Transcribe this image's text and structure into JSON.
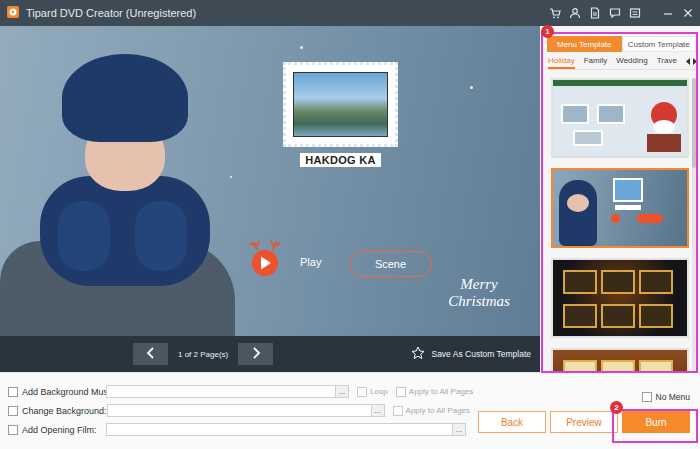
{
  "window": {
    "title": "Tipard DVD Creator (Unregistered)"
  },
  "preview": {
    "title": "HAKDOG KA",
    "play": "Play",
    "scene": "Scene",
    "greeting": "Merry Christmas"
  },
  "pager": {
    "text": "1 of 2 Page(s)",
    "save": "Save As Custom Template"
  },
  "template_tabs": [
    {
      "label": "Menu Template",
      "selected": true
    },
    {
      "label": "Custom Template",
      "selected": false
    }
  ],
  "categories": [
    {
      "label": "Holiday",
      "selected": true
    },
    {
      "label": "Family",
      "selected": false
    },
    {
      "label": "Wedding",
      "selected": false
    },
    {
      "label": "Trave",
      "selected": false
    }
  ],
  "templates": [
    {
      "kind": "christmas",
      "selected": false
    },
    {
      "kind": "kid",
      "selected": true
    },
    {
      "kind": "halloween",
      "selected": false
    },
    {
      "kind": "gold",
      "selected": false
    }
  ],
  "options": [
    {
      "label": "Add Background Music:",
      "checked": false,
      "browse": "...",
      "extras": [
        {
          "label": "Loop",
          "checked": false,
          "disabled": true
        },
        {
          "label": "Apply to All Pages",
          "checked": false,
          "disabled": true
        }
      ]
    },
    {
      "label": "Change Background:",
      "checked": false,
      "browse": "...",
      "extras": [
        {
          "label": "Apply to All Pages",
          "checked": false,
          "disabled": true
        }
      ]
    },
    {
      "label": "Add Opening Film:",
      "checked": false,
      "browse": "...",
      "extras": []
    }
  ],
  "no_menu": {
    "label": "No Menu",
    "checked": false
  },
  "buttons": [
    {
      "label": "Back",
      "primary": false
    },
    {
      "label": "Preview",
      "primary": false
    },
    {
      "label": "Burn",
      "primary": true
    }
  ],
  "annotations": [
    {
      "label": "1"
    },
    {
      "label": "2"
    }
  ]
}
